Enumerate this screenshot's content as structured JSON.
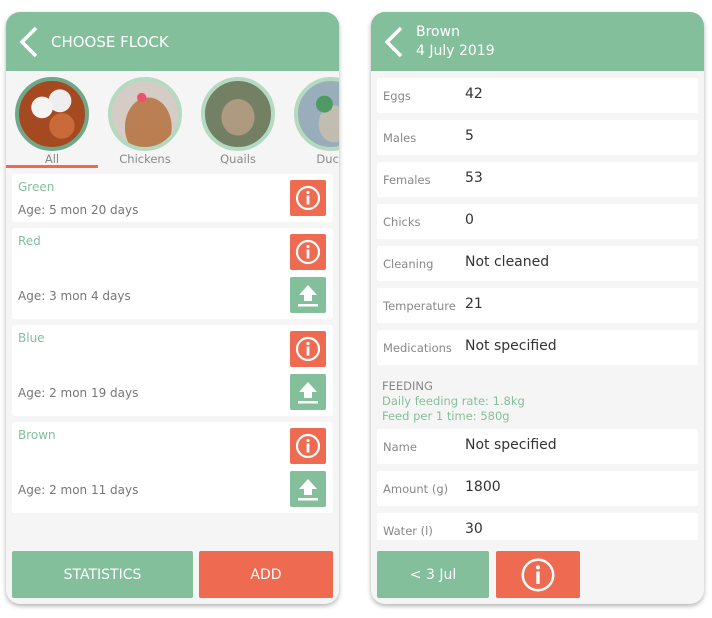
{
  "left": {
    "title": "CHOOSE FLOCK",
    "categories": [
      {
        "label": "All",
        "image": "eggs"
      },
      {
        "label": "Chickens",
        "image": "chicken"
      },
      {
        "label": "Quails",
        "image": "quail"
      },
      {
        "label": "Duck",
        "image": "duck"
      }
    ],
    "flocks": [
      {
        "name": "Green",
        "age": "Age:  5 mon 20 days"
      },
      {
        "name": "Red",
        "age": "Age:  3 mon 4 days"
      },
      {
        "name": "Blue",
        "age": "Age:  2 mon 19 days"
      },
      {
        "name": "Brown",
        "age": "Age:  2 mon 11 days"
      }
    ],
    "statistics": "STATISTICS",
    "add": "ADD"
  },
  "right": {
    "title": "Brown",
    "date": "4 July 2019",
    "rows": [
      {
        "label": "Eggs",
        "value": "42"
      },
      {
        "label": "Males",
        "value": "5"
      },
      {
        "label": "Females",
        "value": "53"
      },
      {
        "label": "Chicks",
        "value": "0"
      },
      {
        "label": "Cleaning",
        "value": "Not cleaned"
      },
      {
        "label": "Temperature",
        "value": "21"
      },
      {
        "label": "Medications",
        "value": "Not specified"
      }
    ],
    "feeding": {
      "heading": "FEEDING",
      "daily": "Daily feeding rate: 1.8kg",
      "per_time": "Feed per 1 time: 580g"
    },
    "feed_rows": [
      {
        "label": "Name",
        "value": "Not specified"
      },
      {
        "label": "Amount (g)",
        "value": "1800"
      },
      {
        "label": "Water (l)",
        "value": "30"
      }
    ],
    "prev": "< 3 Jul"
  },
  "colors": {
    "green": "#84bf9c",
    "orange": "#ee6a50"
  }
}
